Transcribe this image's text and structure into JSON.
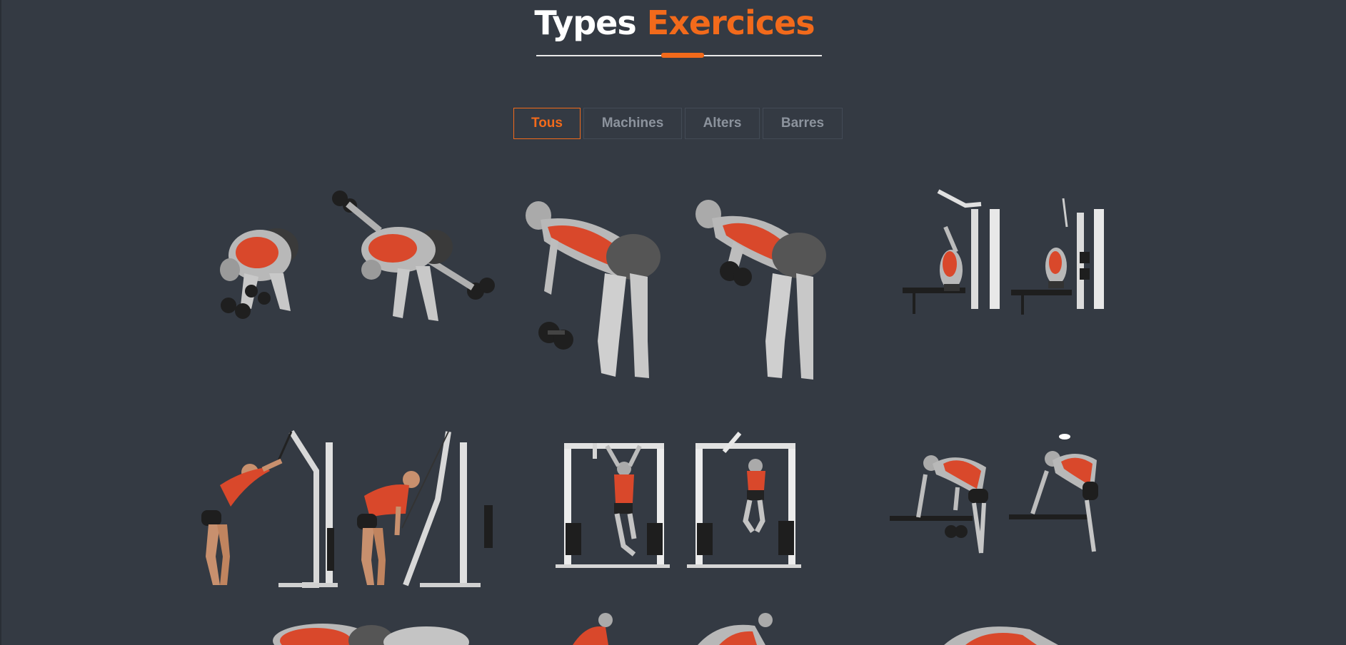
{
  "section": {
    "title_part1": "Types",
    "title_part2": "Exercices"
  },
  "filters": [
    {
      "label": "Tous",
      "active": true
    },
    {
      "label": "Machines",
      "active": false
    },
    {
      "label": "Alters",
      "active": false
    },
    {
      "label": "Barres",
      "active": false
    }
  ],
  "colors": {
    "background": "#343a43",
    "accent": "#f26a1b",
    "muscle_highlight": "#d9482b",
    "filter_text": "#8c939d"
  },
  "exercises": [
    {
      "icon": "dumbbell-rear-delt-fly-icon"
    },
    {
      "icon": "dumbbell-bent-over-row-icon"
    },
    {
      "icon": "lat-pulldown-machine-icon"
    },
    {
      "icon": "cable-straight-arm-pulldown-icon"
    },
    {
      "icon": "assisted-pull-up-machine-icon"
    },
    {
      "icon": "one-arm-dumbbell-row-icon"
    },
    {
      "icon": "exercise-illustration-icon"
    },
    {
      "icon": "exercise-illustration-icon"
    },
    {
      "icon": "exercise-illustration-icon"
    }
  ]
}
